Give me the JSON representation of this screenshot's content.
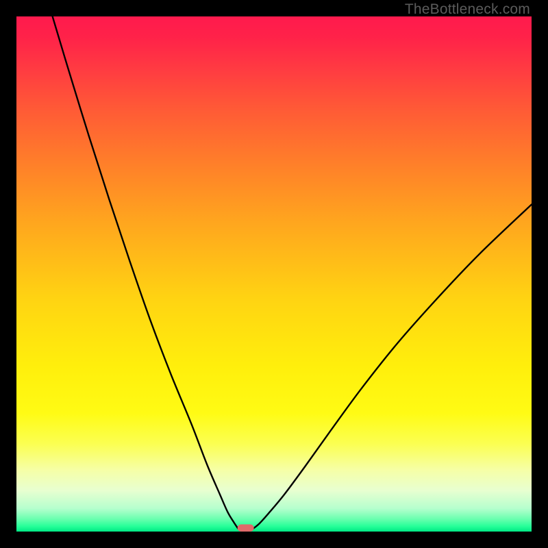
{
  "watermark": "TheBottleneck.com",
  "chart_data": {
    "type": "line",
    "title": "",
    "xlabel": "",
    "ylabel": "",
    "xlim": [
      0,
      100
    ],
    "ylim": [
      0,
      100
    ],
    "annotations": [],
    "background_gradient": {
      "stops": [
        {
          "offset": 0.0,
          "color": "#ff1a4d"
        },
        {
          "offset": 0.04,
          "color": "#ff2249"
        },
        {
          "offset": 0.1,
          "color": "#ff3a42"
        },
        {
          "offset": 0.18,
          "color": "#ff5a36"
        },
        {
          "offset": 0.28,
          "color": "#ff7d2a"
        },
        {
          "offset": 0.4,
          "color": "#ffa61e"
        },
        {
          "offset": 0.55,
          "color": "#ffd412"
        },
        {
          "offset": 0.68,
          "color": "#ffef0c"
        },
        {
          "offset": 0.77,
          "color": "#fffb14"
        },
        {
          "offset": 0.83,
          "color": "#fbff52"
        },
        {
          "offset": 0.88,
          "color": "#f6ffa6"
        },
        {
          "offset": 0.92,
          "color": "#e8ffd0"
        },
        {
          "offset": 0.955,
          "color": "#b6ffce"
        },
        {
          "offset": 0.975,
          "color": "#6cffb0"
        },
        {
          "offset": 0.99,
          "color": "#26ff98"
        },
        {
          "offset": 1.0,
          "color": "#00e884"
        }
      ]
    },
    "series": [
      {
        "name": "bottleneck-curve-left",
        "x": [
          7.0,
          10.0,
          14.0,
          18.0,
          22.0,
          26.0,
          30.0,
          34.0,
          37.0,
          39.5,
          41.0,
          42.2,
          43.0
        ],
        "y": [
          100.0,
          90.0,
          77.0,
          64.5,
          52.5,
          41.0,
          30.5,
          20.8,
          13.0,
          7.2,
          3.8,
          1.8,
          0.6
        ]
      },
      {
        "name": "bottleneck-curve-right",
        "x": [
          46.0,
          47.2,
          49.0,
          52.0,
          56.0,
          61.0,
          67.0,
          74.0,
          82.0,
          90.0,
          100.0
        ],
        "y": [
          0.6,
          1.6,
          3.6,
          7.2,
          12.6,
          19.6,
          27.8,
          36.6,
          45.6,
          54.0,
          63.5
        ]
      }
    ],
    "marker": {
      "name": "optimal-marker",
      "x": 44.5,
      "y": 0.0,
      "width": 3.2,
      "height": 1.4,
      "color": "#e06a6a"
    }
  }
}
